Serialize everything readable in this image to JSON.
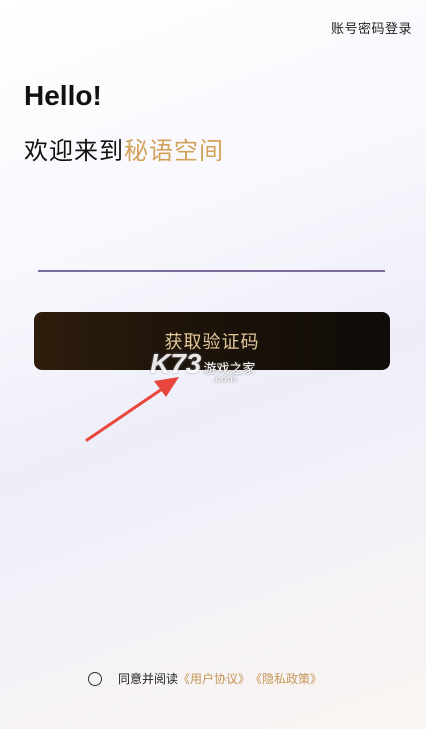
{
  "header": {
    "password_login": "账号密码登录"
  },
  "greeting": {
    "hello": "Hello!",
    "welcome_prefix": "欢迎来到",
    "brand": "秘语空间"
  },
  "phone_input": {
    "value": "",
    "placeholder": ""
  },
  "get_code_button": {
    "label": "获取验证码"
  },
  "watermark": {
    "logo": "K73",
    "text": "游戏之家",
    "sub": ".com"
  },
  "agreement": {
    "prefix": "同意并阅读",
    "user_agreement": "《用户协议》",
    "privacy_policy": "《隐私政策》",
    "checked": false
  },
  "colors": {
    "brand": "#d2a25a",
    "button_text": "#e2c79a",
    "input_underline": "#7a6c9e",
    "arrow": "#e8453c"
  },
  "icons": {
    "agree_radio": "radio-circle-icon",
    "annotation_arrow": "arrow-icon"
  }
}
